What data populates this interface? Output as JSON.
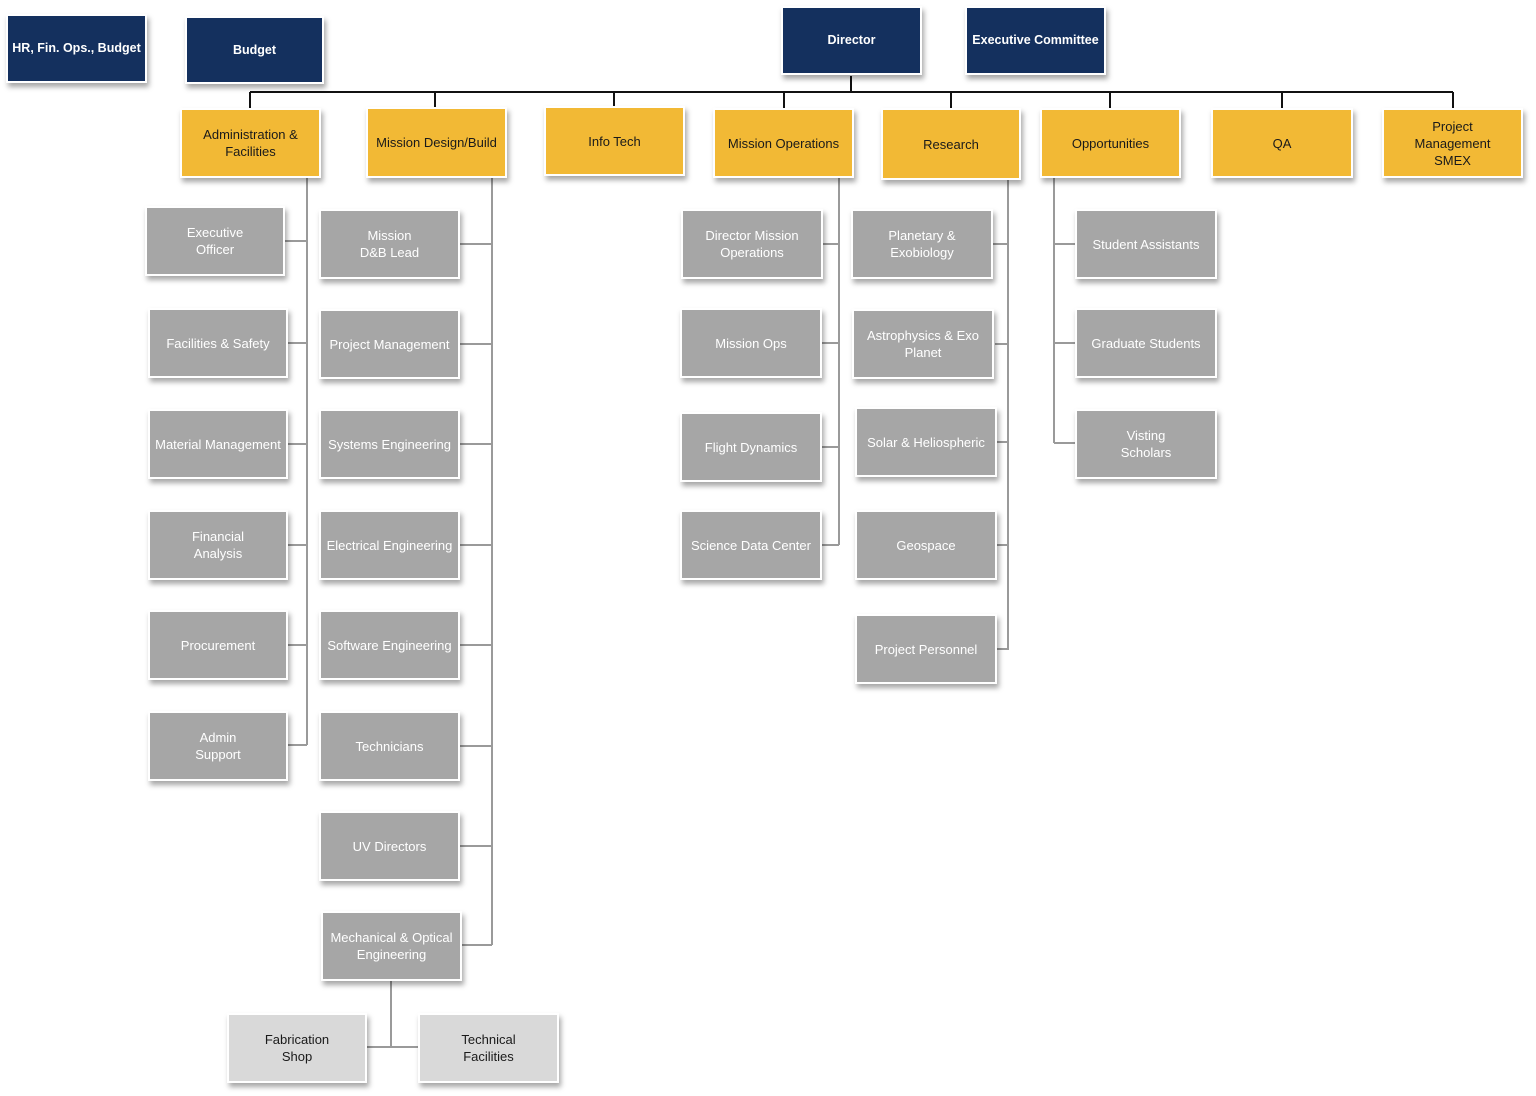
{
  "colors": {
    "navy": "#14305e",
    "gold": "#f2b935",
    "gray": "#a6a6a6",
    "light_gray": "#d9d9d9"
  },
  "top": {
    "hr_fin_ops_budget": "HR, Fin. Ops., Budget",
    "budget": "Budget",
    "director": "Director",
    "executive_committee": "Executive Committee"
  },
  "divisions": {
    "admin": "Administration &\nFacilities",
    "mission_design_build": "Mission Design/Build",
    "info_tech": "Info Tech",
    "mission_operations": "Mission Operations",
    "research": "Research",
    "opportunities": "Opportunities",
    "qa": "QA",
    "pm_smex": "Project\nManagement\nSMEX"
  },
  "admin_units": [
    "Executive\nOfficer",
    "Facilities & Safety",
    "Material Management",
    "Financial\nAnalysis",
    "Procurement",
    "Admin\nSupport"
  ],
  "mdb_units": [
    "Mission\nD&B Lead",
    "Project Management",
    "Systems Engineering",
    "Electrical Engineering",
    "Software Engineering",
    "Technicians",
    "UV Directors",
    "Mechanical & Optical\nEngineering"
  ],
  "mech_sub_units": [
    "Fabrication\nShop",
    "Technical\nFacilities"
  ],
  "mops_units": [
    "Director Mission\nOperations",
    "Mission Ops",
    "Flight Dynamics",
    "Science Data Center"
  ],
  "research_units": [
    "Planetary & Exobiology",
    "Astrophysics & Exo\nPlanet",
    "Solar & Heliospheric",
    "Geospace",
    "Project Personnel"
  ],
  "opportunities_units": [
    "Student Assistants",
    "Graduate Students",
    "Visting\nScholars"
  ]
}
